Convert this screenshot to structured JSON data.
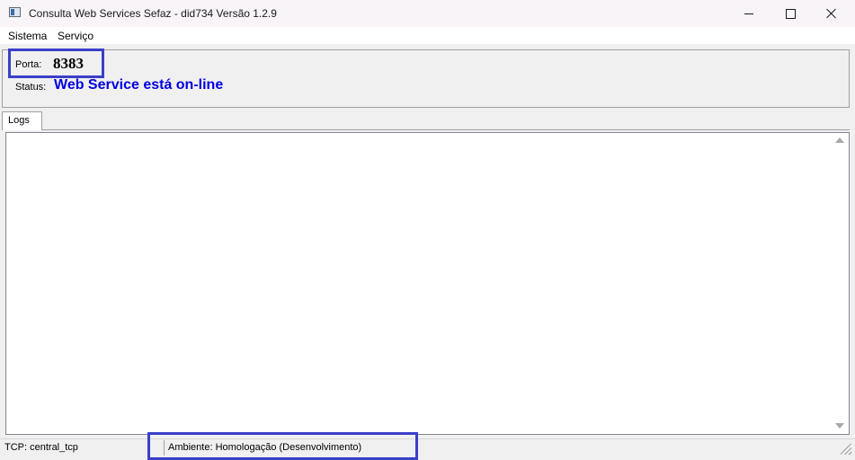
{
  "window": {
    "title": "Consulta Web Services Sefaz - did734 Versão 1.2.9"
  },
  "menu": {
    "items": [
      "Sistema",
      "Serviço"
    ]
  },
  "info": {
    "porta_label": "Porta:",
    "porta_value": "8383",
    "status_label": "Status:",
    "status_value": "Web Service está on-line",
    "status_color": "#0000e0"
  },
  "tabs": [
    {
      "label": "Logs",
      "active": true
    }
  ],
  "statusbar": {
    "tcp": "TCP: central_tcp",
    "ambiente": "Ambiente: Homologação (Desenvolvimento)"
  },
  "highlight_color": "#3b3fc8"
}
